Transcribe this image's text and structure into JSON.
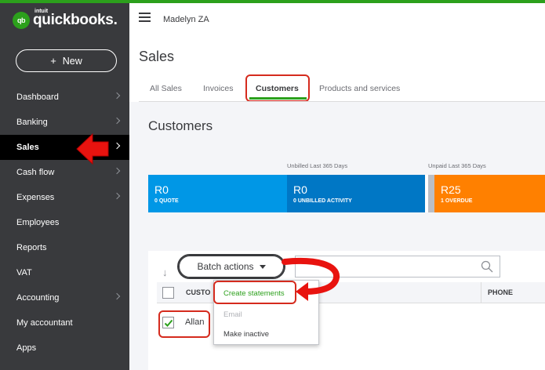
{
  "brand": {
    "logo_mark": "qb",
    "logo_small": "intuit",
    "logo_text": "quickbooks",
    "trademark": "."
  },
  "sidebar": {
    "new_button": {
      "icon": "+",
      "label": "New"
    },
    "items": [
      {
        "label": "Dashboard",
        "has_chevron": true
      },
      {
        "label": "Banking",
        "has_chevron": true
      },
      {
        "label": "Sales",
        "has_chevron": true,
        "active": true
      },
      {
        "label": "Cash flow",
        "has_chevron": true
      },
      {
        "label": "Expenses",
        "has_chevron": true
      },
      {
        "label": "Employees",
        "has_chevron": false
      },
      {
        "label": "Reports",
        "has_chevron": false
      },
      {
        "label": "VAT",
        "has_chevron": false
      },
      {
        "label": "Accounting",
        "has_chevron": true
      },
      {
        "label": "My accountant",
        "has_chevron": false
      },
      {
        "label": "Apps",
        "has_chevron": false
      }
    ]
  },
  "topbar": {
    "company_name": "Madelyn ZA"
  },
  "page": {
    "title": "Sales",
    "tabs": [
      {
        "label": "All Sales"
      },
      {
        "label": "Invoices"
      },
      {
        "label": "Customers",
        "active": true
      },
      {
        "label": "Products and services"
      }
    ]
  },
  "customers": {
    "title": "Customers",
    "captions": {
      "unbilled": "Unbilled Last 365 Days",
      "unpaid": "Unpaid Last 365 Days"
    },
    "tiles": {
      "quote": {
        "amount": "R0",
        "label": "0 QUOTE"
      },
      "unbilled": {
        "amount": "R0",
        "label": "0 UNBILLED ACTIVITY"
      },
      "overdue": {
        "amount": "R25",
        "label": "1 OVERDUE"
      }
    }
  },
  "table": {
    "batch_actions": "Batch actions",
    "headers": {
      "customer": "CUSTO",
      "phone": "PHONE"
    },
    "rows": [
      {
        "name": "Allan",
        "checked": true
      }
    ]
  },
  "dropdown": {
    "items": [
      {
        "label": "Create statements",
        "state": "highlighted"
      },
      {
        "label": "Email",
        "state": "disabled"
      },
      {
        "label": "Make inactive",
        "state": "normal"
      }
    ]
  },
  "colors": {
    "brand_green": "#2ca01c",
    "sidebar_bg": "#393a3d",
    "highlight_red": "#d52b1e",
    "tile_quote": "#0097e6",
    "tile_unbilled": "#0077c5",
    "tile_overdue": "#ff8000"
  },
  "icons": {
    "menu": "hamburger-icon",
    "search": "search-icon",
    "sort": "sort-arrow-icon",
    "check": "checkmark-icon",
    "caret": "caret-down-icon"
  }
}
